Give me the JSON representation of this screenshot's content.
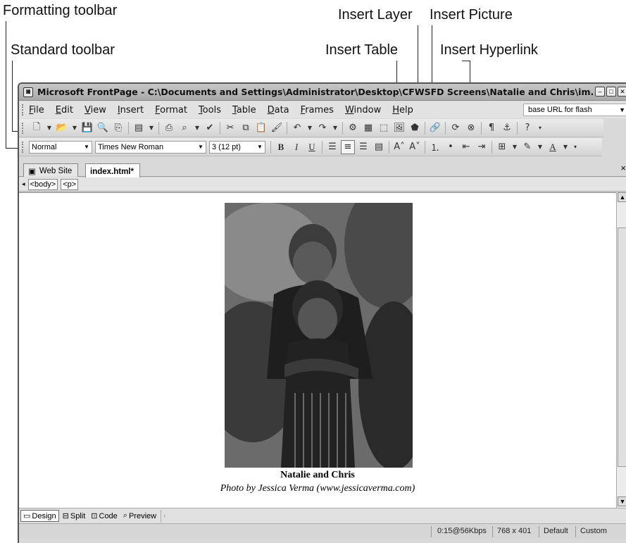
{
  "callouts": {
    "formatting_toolbar": "Formatting toolbar",
    "standard_toolbar": "Standard toolbar",
    "insert_layer": "Insert Layer",
    "insert_picture": "Insert Picture",
    "insert_table": "Insert Table",
    "insert_hyperlink": "Insert Hyperlink"
  },
  "window": {
    "title": "Microsoft FrontPage - C:\\Documents and Settings\\Administrator\\Desktop\\CFWSFD Screens\\Natalie and Chris\\im..."
  },
  "menu": {
    "items": [
      "File",
      "Edit",
      "View",
      "Insert",
      "Format",
      "Tools",
      "Table",
      "Data",
      "Frames",
      "Window",
      "Help"
    ],
    "url_box": "base URL for flash"
  },
  "formatting": {
    "style": "Normal",
    "font": "Times New Roman",
    "size": "3  (12 pt)",
    "bold": "B",
    "italic": "I",
    "underline": "U"
  },
  "tabs": {
    "web_site": "Web Site",
    "file": "index.html*"
  },
  "tags": [
    "<body>",
    "<p>"
  ],
  "content": {
    "caption_title": "Natalie and Chris",
    "caption_credit": "Photo by Jessica Verma (www.jessicaverma.com)"
  },
  "views": {
    "design": "Design",
    "split": "Split",
    "code": "Code",
    "preview": "Preview"
  },
  "status": {
    "speed": "0:15@56Kbps",
    "dimensions": "768 x 401",
    "mode1": "Default",
    "mode2": "Custom"
  }
}
